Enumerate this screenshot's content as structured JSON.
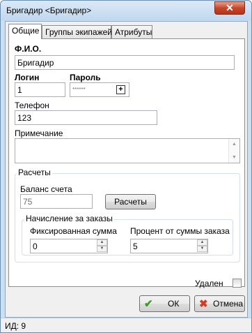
{
  "window": {
    "title": "Бригадир <Бригадир>",
    "close_symbol": "✕"
  },
  "tabs": [
    {
      "label": "Общие",
      "active": true
    },
    {
      "label": "Группы экипажей",
      "active": false
    },
    {
      "label": "Атрибуты",
      "active": false
    }
  ],
  "general": {
    "fio_label": "Ф.И.О.",
    "fio_value": "Бригадир",
    "login_label": "Логин",
    "login_value": "1",
    "password_label": "Пароль",
    "password_value": "******",
    "password_plus": "+",
    "phone_label": "Телефон",
    "phone_value": "123",
    "note_label": "Примечание",
    "note_value": ""
  },
  "payments": {
    "group_title": "Расчеты",
    "balance_label": "Баланс счета",
    "balance_value": "75",
    "payments_button": "Расчеты",
    "accrual": {
      "group_title": "Начисление за заказы",
      "fixed_label": "Фиксированная сумма",
      "fixed_value": "0",
      "percent_label": "Процент от суммы заказа",
      "percent_value": "5"
    }
  },
  "deleted": {
    "label": "Удален",
    "checked": false
  },
  "actions": {
    "ok_label": "ОК",
    "ok_icon": "check-icon",
    "ok_icon_color": "#3a9a2a",
    "cancel_label": "Отмена",
    "cancel_icon": "cross-icon",
    "cancel_icon_color": "#d23a2a"
  },
  "status": {
    "id_text": "ИД: 9"
  }
}
